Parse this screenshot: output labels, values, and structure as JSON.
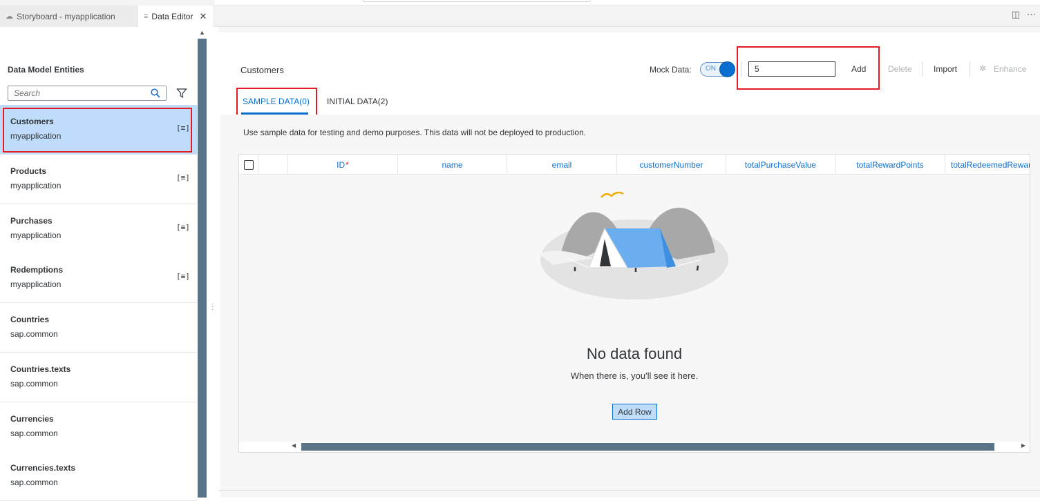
{
  "tabs": [
    {
      "label": "Storyboard - myapplication",
      "icon": "cloud-icon"
    },
    {
      "label": "Data Editor",
      "icon": "doc-lines-icon"
    }
  ],
  "sidebar": {
    "title": "Data Model Entities",
    "search_placeholder": "Search",
    "entities": [
      {
        "name": "Customers",
        "namespace": "myapplication",
        "has_icon": true,
        "selected": true
      },
      {
        "name": "Products",
        "namespace": "myapplication",
        "has_icon": true
      },
      {
        "name": "Purchases",
        "namespace": "myapplication",
        "has_icon": true
      },
      {
        "name": "Redemptions",
        "namespace": "myapplication",
        "has_icon": true
      },
      {
        "name": "Countries",
        "namespace": "sap.common"
      },
      {
        "name": "Countries.texts",
        "namespace": "sap.common"
      },
      {
        "name": "Currencies",
        "namespace": "sap.common"
      },
      {
        "name": "Currencies.texts",
        "namespace": "sap.common"
      }
    ],
    "entity_icon_text": "[≡]"
  },
  "main": {
    "title": "Customers",
    "mock_label": "Mock Data:",
    "toggle_text": "ON",
    "count_value": "5",
    "add_label": "Add",
    "delete_label": "Delete",
    "import_label": "Import",
    "enhance_label": "Enhance",
    "tabs": [
      {
        "label": "SAMPLE DATA(0)",
        "active": true
      },
      {
        "label": "INITIAL DATA(2)",
        "active": false
      }
    ],
    "info_text": "Use sample data for testing and demo purposes. This data will not be deployed to production.",
    "columns": [
      "ID",
      "name",
      "email",
      "customerNumber",
      "totalPurchaseValue",
      "totalRewardPoints",
      "totalRedeemedRewar"
    ],
    "required_marker": "*",
    "empty_title": "No data found",
    "empty_subtitle": "When there is, you'll see it here.",
    "add_row_label": "Add Row"
  },
  "colors": {
    "accent": "#0a6ed1",
    "selected_bg": "#bfdcfa",
    "highlight": "#e01b24",
    "scroll_thumb": "#5b7387"
  }
}
